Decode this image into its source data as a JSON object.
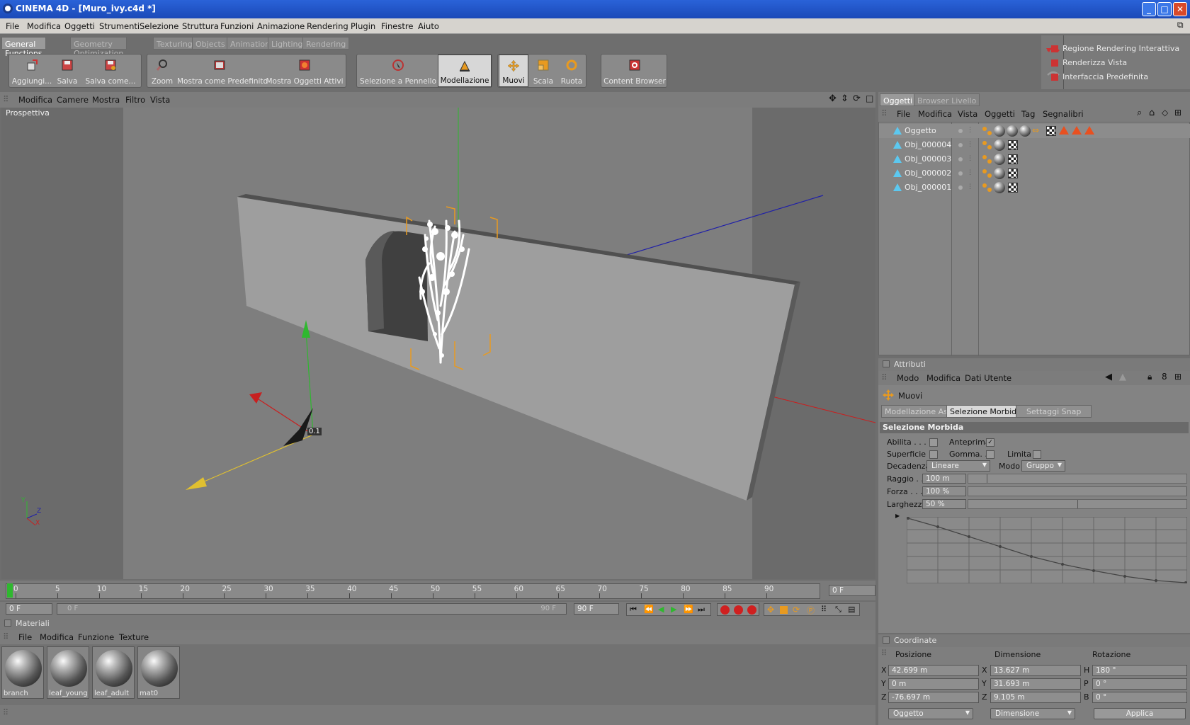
{
  "window": {
    "title": "CINEMA 4D - [Muro_ivy.c4d *]"
  },
  "menubar": [
    "File",
    "Modifica",
    "Oggetti",
    "Strumenti",
    "Selezione",
    "Struttura",
    "Funzioni",
    "Animazione",
    "Rendering",
    "Plugin",
    "Finestre",
    "Aiuto"
  ],
  "palette_tabs": [
    "General Functions",
    "Geometry Optimization",
    "Texturing",
    "Objects",
    "Animation",
    "Lighting",
    "Rendering"
  ],
  "toolbar": {
    "add": "Aggiungi...",
    "save": "Salva",
    "save_as": "Salva come...",
    "zoom": "Zoom",
    "show_default": "Mostra come Predefinito",
    "show_active": "Mostra Oggetti Attivi",
    "brush_select": "Selezione a Pennello",
    "modeling": "Modellazione",
    "move": "Muovi",
    "scale": "Scala",
    "rotate": "Ruota",
    "content_browser": "Content Browser"
  },
  "render_panel": [
    "Regione Rendering Interattiva",
    "Renderizza Vista",
    "Interfaccia Predefinita"
  ],
  "viewport": {
    "menu": [
      "Modifica",
      "Camere",
      "Mostra",
      "Filtro",
      "Vista"
    ],
    "label": "Prospettiva",
    "axis_value": "0.1",
    "axis_letters": {
      "y": "Y",
      "z": "Z",
      "x": "X"
    }
  },
  "timeline": {
    "ticks": [
      "0",
      "5",
      "10",
      "15",
      "20",
      "25",
      "30",
      "35",
      "40",
      "45",
      "50",
      "55",
      "60",
      "65",
      "70",
      "75",
      "80",
      "85",
      "90"
    ],
    "current_frame": "0 F",
    "start_frame": "0 F",
    "range_start": "0 F",
    "range_end": "90 F",
    "end_frame": "90 F"
  },
  "materials": {
    "title": "Materiali",
    "menu": [
      "File",
      "Modifica",
      "Funzione",
      "Texture"
    ],
    "items": [
      "branch",
      "leaf_young",
      "leaf_adult",
      "mat0"
    ]
  },
  "objects": {
    "tabs": [
      "Oggetti",
      "Browser Livello"
    ],
    "menu": [
      "File",
      "Modifica",
      "Vista",
      "Oggetti",
      "Tag",
      "Segnalibri"
    ],
    "rows": [
      "Oggetto",
      "Obj_000004",
      "Obj_000003",
      "Obj_000002",
      "Obj_000001"
    ]
  },
  "attributes": {
    "title": "Attributi",
    "menu": [
      "Modo",
      "Modifica",
      "Dati Utente"
    ],
    "tool": "Muovi",
    "tabs": [
      "Modellazione Assi",
      "Selezione Morbida",
      "Settaggi Snap"
    ],
    "section": "Selezione Morbida",
    "abilita": "Abilita . . .",
    "anteprima": "Anteprima",
    "superficie": "Superficie",
    "gomma": "Gomma. .",
    "limita": "Limita",
    "decadenza_label": "Decadenza",
    "decadenza_value": "Lineare",
    "modo_label": "Modo",
    "modo_value": "Gruppo",
    "raggio_label": "Raggio . .",
    "raggio_value": "100 m",
    "forza_label": "Forza . . .",
    "forza_value": "100 %",
    "forza_level": 1.0,
    "larghezza_label": "Larghezza",
    "larghezza_value": "50 %",
    "larghezza_level": 0.5
  },
  "coordinates": {
    "title": "Coordinate",
    "headers": [
      "Posizione",
      "Dimensione",
      "Rotazione"
    ],
    "rows": [
      {
        "axis": "X",
        "pos": "42.699 m",
        "dim_axis": "X",
        "dim": "13.627 m",
        "rot_axis": "H",
        "rot": "180 °"
      },
      {
        "axis": "Y",
        "pos": "0 m",
        "dim_axis": "Y",
        "dim": "31.693 m",
        "rot_axis": "P",
        "rot": "0 °"
      },
      {
        "axis": "Z",
        "pos": "-76.697 m",
        "dim_axis": "Z",
        "dim": "9.105 m",
        "rot_axis": "B",
        "rot": "0 °"
      }
    ],
    "mode_left": "Oggetto",
    "mode_right": "Dimensione",
    "apply": "Applica"
  },
  "colors": {
    "accent_orange": "#e89a20",
    "selection_blue": "#2a62d8",
    "axis_green": "#2fb82f",
    "axis_red": "#c82020",
    "axis_blue": "#2020a8"
  }
}
